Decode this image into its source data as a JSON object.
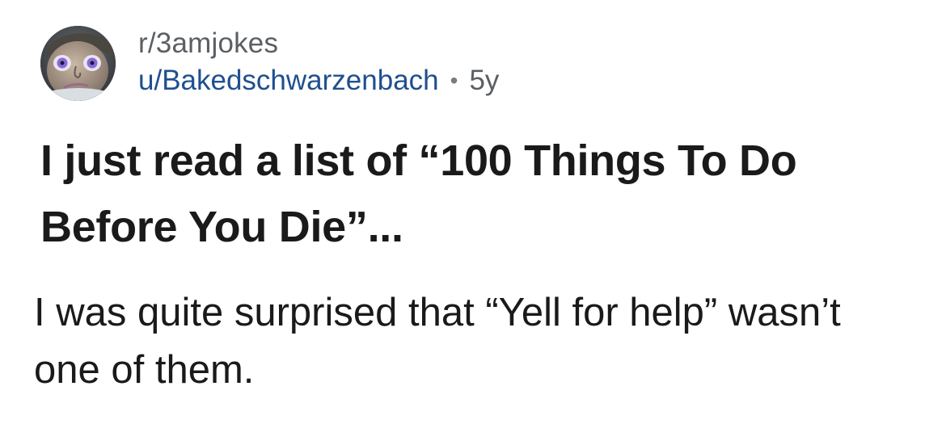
{
  "post": {
    "subreddit": "r/3amjokes",
    "username": "u/Bakedschwarzenbach",
    "separator": "•",
    "age": "5y",
    "title": "I just read a list of “100 Things To Do Before You Die”...",
    "body": "I was quite surprised that “Yell for help” wasn’t one of them."
  },
  "avatar": {
    "icon": "animated-face-avatar",
    "background": "#3b3f45",
    "eye_color": "#8a6ad8"
  },
  "colors": {
    "subreddit_text": "#5b5f63",
    "username_link": "#1f4f8f",
    "title_text": "#1a1a1b",
    "body_text": "#1a1a1b"
  }
}
